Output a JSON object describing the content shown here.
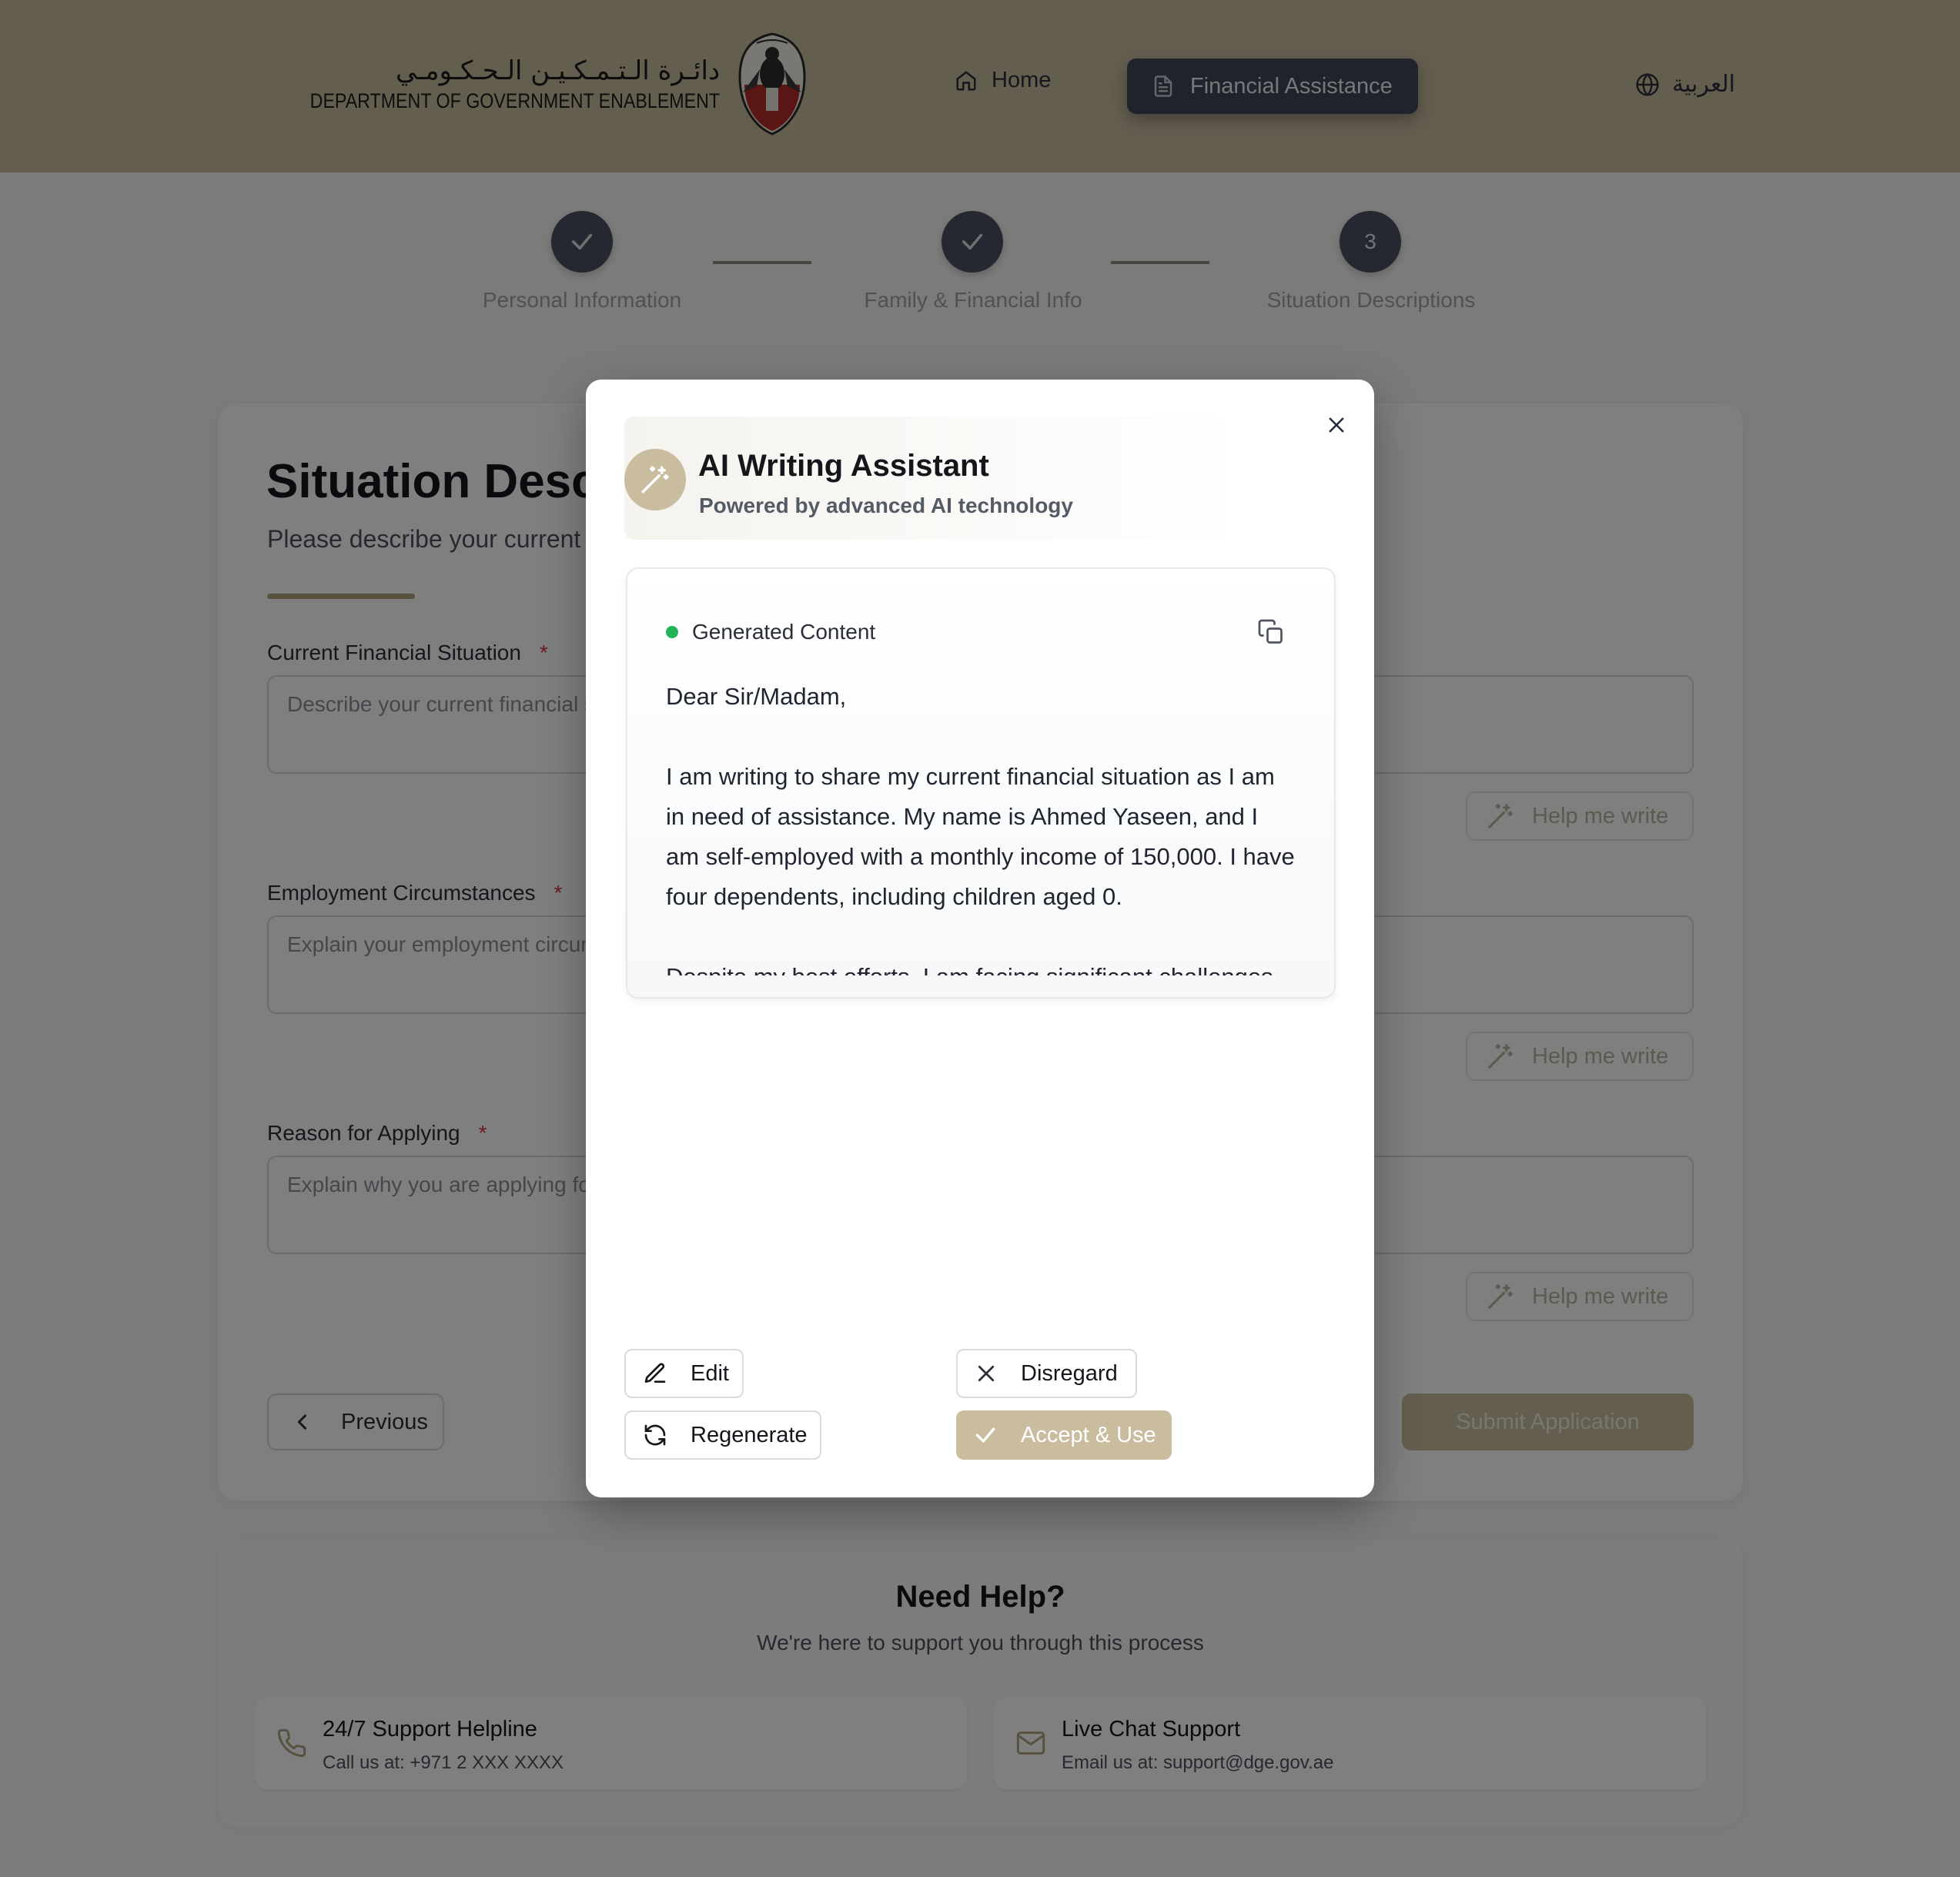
{
  "header": {
    "logo_arabic": "دائـرة الـتـمـكـيـن الـحـكـومـي",
    "logo_english": "DEPARTMENT OF GOVERNMENT ENABLEMENT",
    "nav": {
      "home": "Home",
      "financial_assistance": "Financial Assistance",
      "language": "العربية"
    }
  },
  "stepper": {
    "steps": [
      {
        "label": "Personal Information",
        "status": "complete"
      },
      {
        "label": "Family & Financial Info",
        "status": "complete"
      },
      {
        "label": "Situation Descriptions",
        "status": "current",
        "number": "3"
      }
    ]
  },
  "form": {
    "title": "Situation Descriptions",
    "subtitle": "Please describe your current situation",
    "fields": [
      {
        "label": "Current Financial Situation",
        "required_mark": "*",
        "placeholder": "Describe your current financial situation"
      },
      {
        "label": "Employment Circumstances",
        "required_mark": "*",
        "placeholder": "Explain your employment circumstances"
      },
      {
        "label": "Reason for Applying",
        "required_mark": "*",
        "placeholder": "Explain why you are applying for financial assistance"
      }
    ],
    "help_me_write": "Help me write",
    "previous": "Previous",
    "submit": "Submit Application"
  },
  "help": {
    "title": "Need Help?",
    "subtitle": "We're here to support you through this process",
    "helpline_title": "24/7 Support Helpline",
    "helpline_desc": "Call us at: +971 2 XXX XXXX",
    "chat_title": "Live Chat Support",
    "chat_desc": "Email us at: support@dge.gov.ae"
  },
  "modal": {
    "title": "AI Writing Assistant",
    "subtitle": "Powered by advanced AI technology",
    "generated_label": "Generated Content",
    "generated_text": "Dear Sir/Madam,\n\nI am writing to share my current financial situation as I am in need of assistance. My name is Ahmed Yaseen, and I am self-employed with a monthly income of 150,000. I have four dependents, including children aged 0.\n\nDespite my best efforts, I am facing significant challenges in meeting our basic needs due to the limited income and growing expenses. The financial strain has a profound impact on my daily life and the well-being of my family. It is becoming increasingly difficult to cover essential expenses such as food, shelter, and healthcare for my loved ones.",
    "edit": "Edit",
    "disregard": "Disregard",
    "regenerate": "Regenerate",
    "accept": "Accept & Use"
  },
  "colors": {
    "accent": "#c9bc9f",
    "nav_active": "#3f4656",
    "status_green": "#21b457",
    "required_red": "#d23a3a"
  }
}
